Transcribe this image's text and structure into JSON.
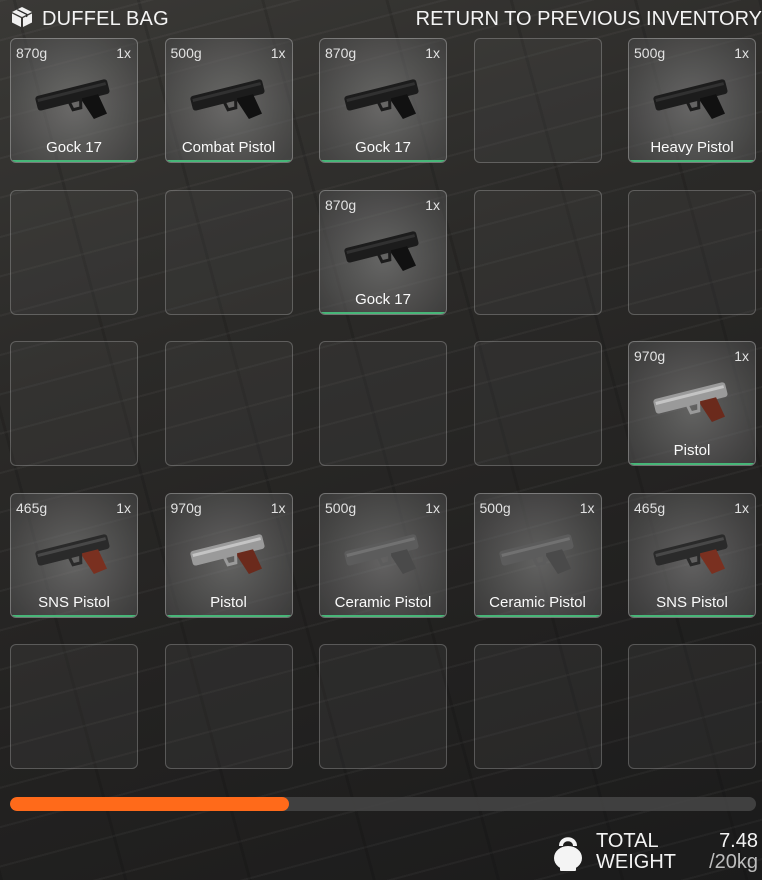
{
  "header": {
    "title": "DUFFEL BAG",
    "return_label": "RETURN TO PREVIOUS INVENTORY",
    "bag_icon": "box-icon"
  },
  "slots": [
    {
      "weight": "870g",
      "count": "1x",
      "name": "Gock 17",
      "icon": "pistol-black-icon"
    },
    {
      "weight": "500g",
      "count": "1x",
      "name": "Combat Pistol",
      "icon": "pistol-black-icon"
    },
    {
      "weight": "870g",
      "count": "1x",
      "name": "Gock 17",
      "icon": "pistol-black-icon"
    },
    null,
    {
      "weight": "500g",
      "count": "1x",
      "name": "Heavy Pistol",
      "icon": "pistol-black-icon"
    },
    null,
    null,
    {
      "weight": "870g",
      "count": "1x",
      "name": "Gock 17",
      "icon": "pistol-black-icon"
    },
    null,
    null,
    null,
    null,
    null,
    null,
    {
      "weight": "970g",
      "count": "1x",
      "name": "Pistol",
      "icon": "pistol-silver-wood-icon"
    },
    {
      "weight": "465g",
      "count": "1x",
      "name": "SNS Pistol",
      "icon": "pistol-wood-icon"
    },
    {
      "weight": "970g",
      "count": "1x",
      "name": "Pistol",
      "icon": "pistol-silver-wood-icon"
    },
    {
      "weight": "500g",
      "count": "1x",
      "name": "Ceramic Pistol",
      "icon": "pistol-gray-icon"
    },
    {
      "weight": "500g",
      "count": "1x",
      "name": "Ceramic Pistol",
      "icon": "pistol-gray-icon"
    },
    {
      "weight": "465g",
      "count": "1x",
      "name": "SNS Pistol",
      "icon": "pistol-wood-icon"
    },
    null,
    null,
    null,
    null,
    null
  ],
  "capacity": {
    "fill_fraction": 0.374,
    "total_label": "TOTAL",
    "weight_label": "WEIGHT",
    "current": "7.48",
    "max": "/20kg",
    "icon": "kettlebell-icon"
  },
  "colors": {
    "progress": "#ff6a1a",
    "filled_slot_accent": "#47b678"
  }
}
